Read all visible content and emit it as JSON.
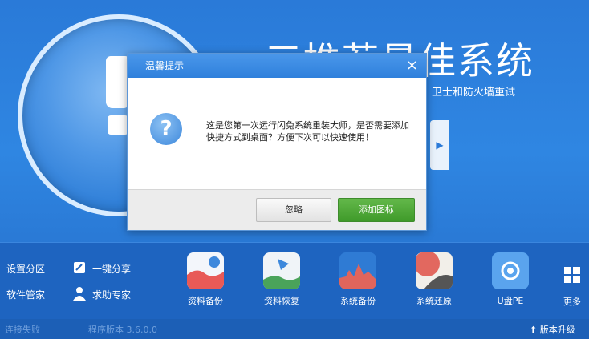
{
  "hero": {
    "headline": "三推荐最佳系统",
    "subline": "卫士和防火墙重试"
  },
  "menu": {
    "partition": "设置分区",
    "software": "软件管家",
    "share": "一键分享",
    "expert": "求助专家"
  },
  "tools": [
    {
      "label": "资料备份",
      "color": "#e85a57"
    },
    {
      "label": "资料恢复",
      "color": "#4aa35a"
    },
    {
      "label": "系统备份",
      "color": "#e0655c"
    },
    {
      "label": "系统还原",
      "color": "#c94c47"
    },
    {
      "label": "U盘PE",
      "color": "#5aa4ee"
    }
  ],
  "more_label": "更多",
  "status": {
    "left": "连接失败",
    "version": "程序版本 3.6.0.0",
    "upgrade": "版本升级"
  },
  "dialog": {
    "title": "温馨提示",
    "close": "×",
    "message": "这是您第一次运行闪兔系统重装大师，是否需要添加快捷方式到桌面？方便下次可以快速使用！",
    "ignore": "忽略",
    "add": "添加图标"
  }
}
